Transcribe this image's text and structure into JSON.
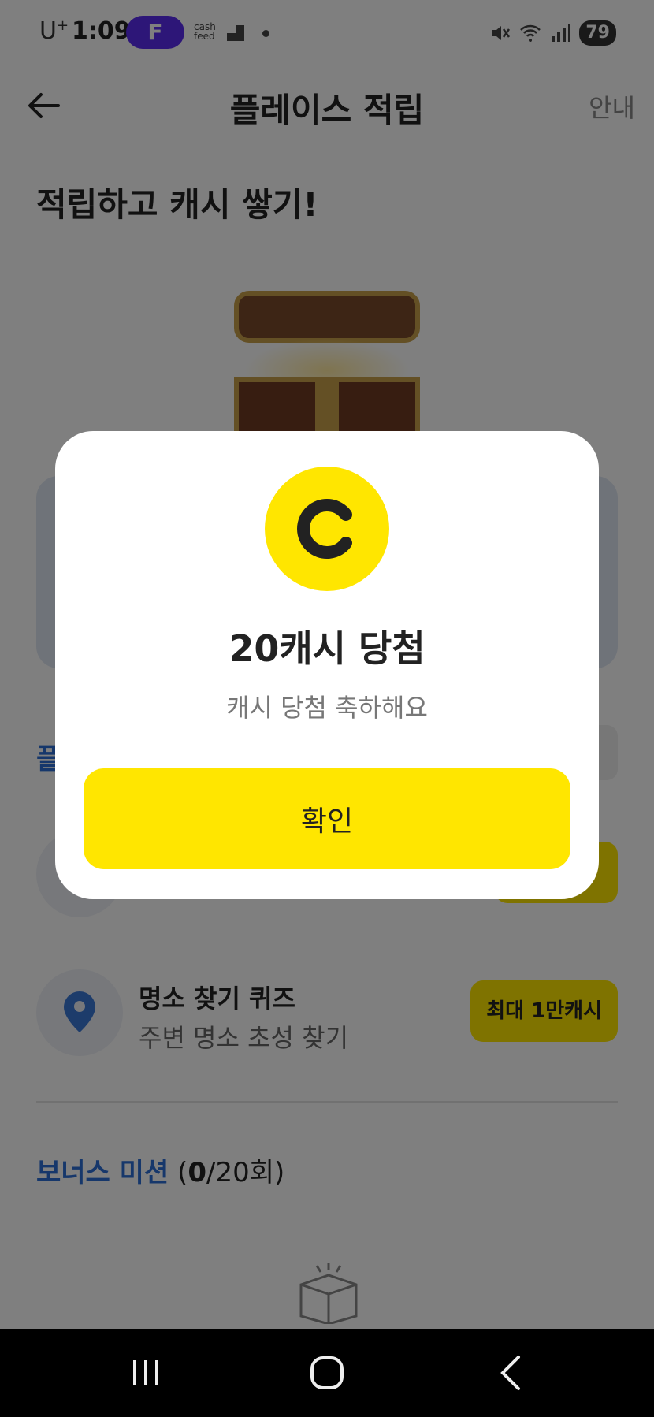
{
  "status_bar": {
    "carrier": "U",
    "carrier_sup": "+",
    "time": "1:09",
    "app_badge": "F",
    "cashfeed": "cash feed",
    "battery": "79"
  },
  "header": {
    "title": "플레이스 적립",
    "guide": "안내"
  },
  "hero": {
    "title": "적립하고 캐시 쌓기!"
  },
  "section_peek": "플",
  "missions": [
    {
      "title": "",
      "subtitle": "",
      "button": ""
    },
    {
      "title": "명소 찾기 퀴즈",
      "subtitle": "주변 명소 초성 찾기",
      "button": "최대 1만캐시"
    }
  ],
  "bonus": {
    "label": "보너스 미션",
    "count_open": " (",
    "count_done": "0",
    "count_rest": "/20회)"
  },
  "modal": {
    "title": "20캐시 당첨",
    "subtitle": "캐시 당첨 축하해요",
    "confirm": "확인"
  },
  "colors": {
    "accent_yellow": "#ffe600",
    "link_blue": "#2c6fd6",
    "app_purple": "#5b2df0"
  }
}
